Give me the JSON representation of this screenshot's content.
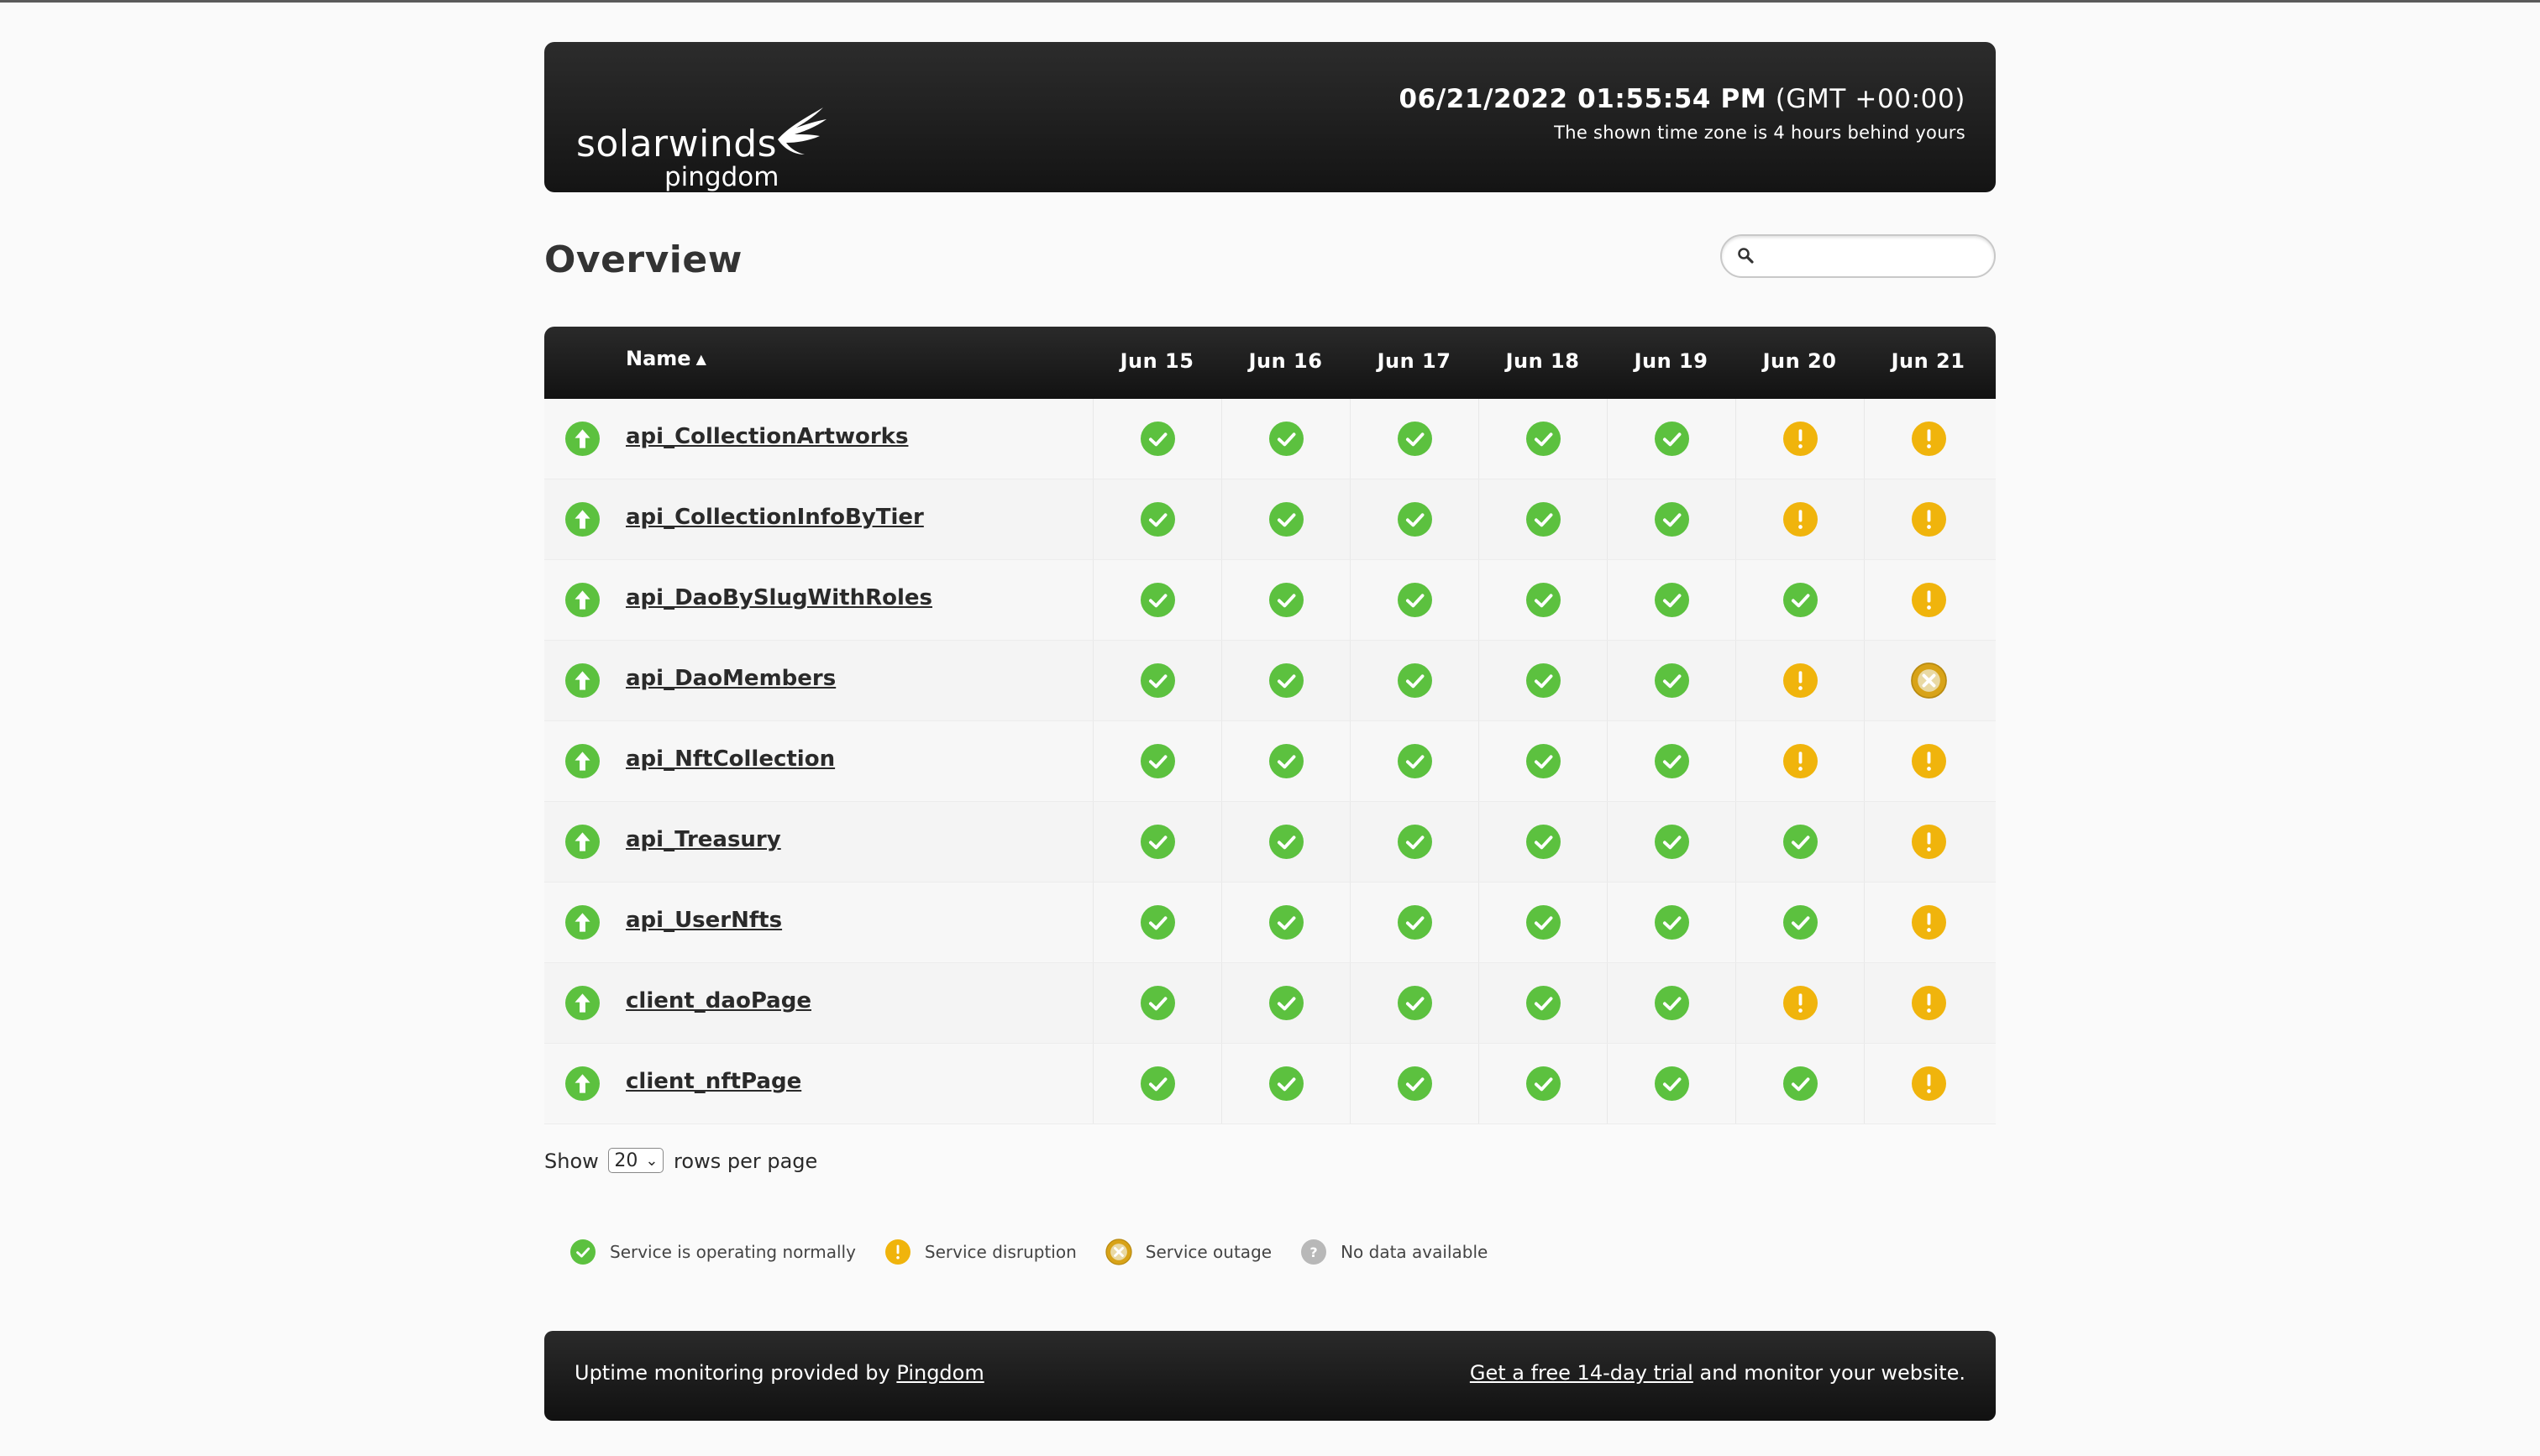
{
  "header": {
    "brand": "solarwinds",
    "product": "pingdom",
    "datetime": "06/21/2022 01:55:54 PM",
    "timezone": "(GMT +00:00)",
    "tz_note": "The shown time zone is 4 hours behind yours"
  },
  "overview": {
    "title": "Overview",
    "search_placeholder": ""
  },
  "table": {
    "name_header": "Name",
    "sort_indicator": "▲",
    "days": [
      "Jun 15",
      "Jun 16",
      "Jun 17",
      "Jun 18",
      "Jun 19",
      "Jun 20",
      "Jun 21"
    ],
    "rows": [
      {
        "name": "api_CollectionArtworks",
        "status": "up",
        "days": [
          "ok",
          "ok",
          "ok",
          "ok",
          "ok",
          "disruption",
          "disruption"
        ]
      },
      {
        "name": "api_CollectionInfoByTier",
        "status": "up",
        "days": [
          "ok",
          "ok",
          "ok",
          "ok",
          "ok",
          "disruption",
          "disruption"
        ]
      },
      {
        "name": "api_DaoBySlugWithRoles",
        "status": "up",
        "days": [
          "ok",
          "ok",
          "ok",
          "ok",
          "ok",
          "ok",
          "disruption"
        ]
      },
      {
        "name": "api_DaoMembers",
        "status": "up",
        "days": [
          "ok",
          "ok",
          "ok",
          "ok",
          "ok",
          "disruption",
          "outage"
        ]
      },
      {
        "name": "api_NftCollection",
        "status": "up",
        "days": [
          "ok",
          "ok",
          "ok",
          "ok",
          "ok",
          "disruption",
          "disruption"
        ]
      },
      {
        "name": "api_Treasury",
        "status": "up",
        "days": [
          "ok",
          "ok",
          "ok",
          "ok",
          "ok",
          "ok",
          "disruption"
        ]
      },
      {
        "name": "api_UserNfts",
        "status": "up",
        "days": [
          "ok",
          "ok",
          "ok",
          "ok",
          "ok",
          "ok",
          "disruption"
        ]
      },
      {
        "name": "client_daoPage",
        "status": "up",
        "days": [
          "ok",
          "ok",
          "ok",
          "ok",
          "ok",
          "disruption",
          "disruption"
        ]
      },
      {
        "name": "client_nftPage",
        "status": "up",
        "days": [
          "ok",
          "ok",
          "ok",
          "ok",
          "ok",
          "ok",
          "disruption"
        ]
      }
    ]
  },
  "pager": {
    "show": "Show",
    "rows_value": "20",
    "suffix": "rows per page"
  },
  "legend": [
    {
      "kind": "ok",
      "label": "Service is operating normally"
    },
    {
      "kind": "disruption",
      "label": "Service disruption"
    },
    {
      "kind": "outage",
      "label": "Service outage"
    },
    {
      "kind": "nodata",
      "label": "No data available"
    }
  ],
  "footer": {
    "left_text": "Uptime monitoring provided by",
    "left_link": "Pingdom",
    "right_link": "Get a free 14-day trial",
    "right_text": "and monitor your website."
  },
  "colors": {
    "ok": "#5cc13f",
    "disruption": "#f0b40c",
    "outage": "#d8a318",
    "nodata": "#b8b8b8",
    "header_bg": "#1a1a1a"
  }
}
